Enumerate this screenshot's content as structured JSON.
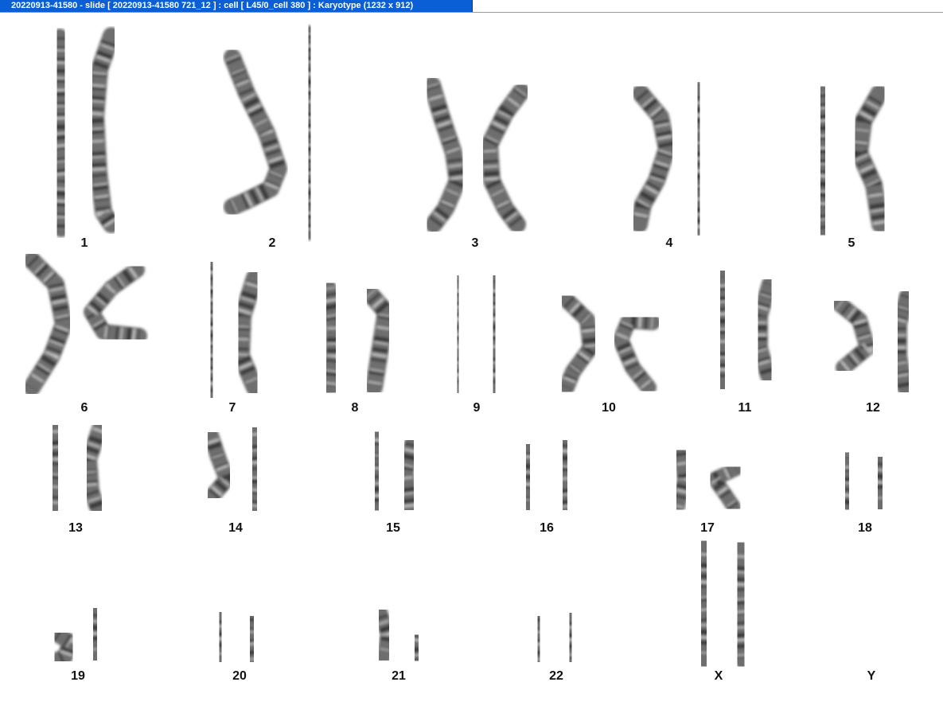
{
  "window": {
    "title": "20220913-41580 - slide [ 20220913-41580 721_12 ] : cell [ L45/0_cell 380 ] : Karyotype  (1232 x 912)"
  },
  "colors": {
    "title_tab": "#0a5fd6",
    "chromosome": "#6e6e6e",
    "band_dark": "#2a2a2a",
    "band_light": "#d8d8d8"
  },
  "karyotype": {
    "labels": [
      "1",
      "2",
      "3",
      "4",
      "5",
      "6",
      "7",
      "8",
      "9",
      "10",
      "11",
      "12",
      "13",
      "14",
      "15",
      "16",
      "17",
      "18",
      "19",
      "20",
      "21",
      "22",
      "X",
      "Y"
    ],
    "y_present": false
  }
}
